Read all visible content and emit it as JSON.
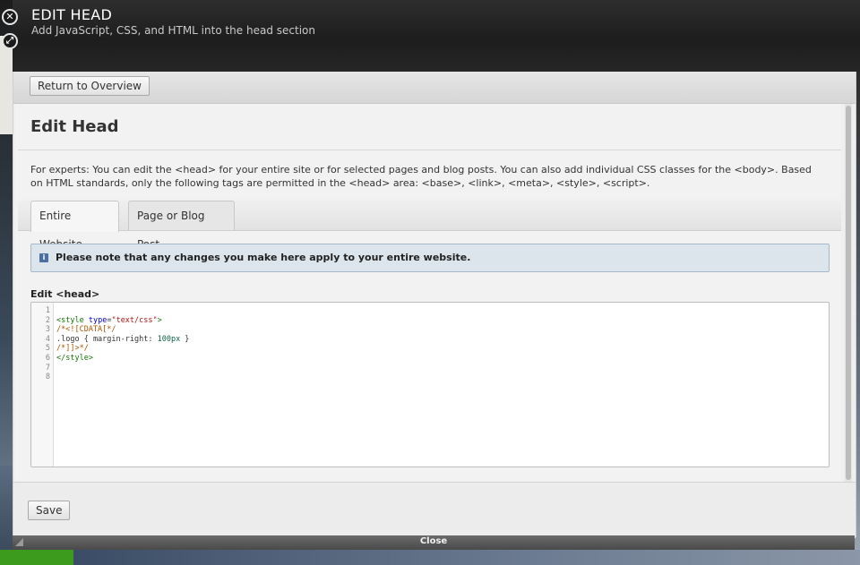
{
  "header": {
    "title": "EDIT HEAD",
    "subtitle": "Add JavaScript, CSS, and HTML into the head section"
  },
  "toolbar": {
    "return_label": "Return to Overview"
  },
  "page": {
    "title": "Edit Head",
    "intro": "For experts: You can edit the <head> for your entire site or for selected pages and blog posts. You can also add individual CSS classes for the <body>. Based on HTML standards, only the following tags are permitted in the <head> area: <base>, <link>, <meta>, <style>, <script>."
  },
  "tabs": [
    {
      "label": "Entire Website",
      "active": true
    },
    {
      "label": "Page or Blog Post",
      "active": false
    }
  ],
  "notice": {
    "text": "Please note that any changes you make here apply to your entire website.",
    "icon": "info-icon"
  },
  "editor": {
    "label": "Edit <head>",
    "line_numbers": [
      "1",
      "2",
      "3",
      "4",
      "5",
      "6",
      "7",
      "8"
    ],
    "lines": {
      "l2_open": "<style",
      "l2_attr": "type",
      "l2_eq": "=",
      "l2_val": "\"text/css\"",
      "l2_close": ">",
      "l3": "/*<![CDATA[*/",
      "l4_sel": ".logo { margin-right: ",
      "l4_val": "100px",
      "l4_end": " }",
      "l5": "/*]]>*/",
      "l6": "</style>"
    }
  },
  "footer": {
    "save_label": "Save"
  },
  "closebar": {
    "label": "Close"
  },
  "colors": {
    "header_bg": "#222222",
    "notice_bg": "#dde5ec",
    "tag": "#117700",
    "attr": "#0000cc",
    "string": "#aa1111"
  }
}
